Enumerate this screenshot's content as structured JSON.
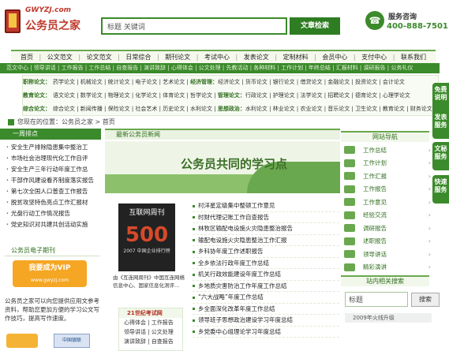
{
  "header": {
    "logo_en": "GWYZJ.com",
    "logo_cn": "公务员之家",
    "search_placeholder": "标题 关键词",
    "search_button": "文章检索",
    "service_title": "服务咨询",
    "service_phone": "400-888-7501"
  },
  "nav": {
    "items": [
      "首页",
      "公文范文",
      "论文范文",
      "日常综合",
      "期刊论文",
      "考试中心",
      "发表论文",
      "定制材料",
      "会员中心",
      "支付中心",
      "联系我们"
    ]
  },
  "subnav": {
    "text": "范文中心 | 领导讲话 | 工作报告 | 工作总结 | 自查报告 | 演讲致辞 | 心得体会 | 公文处理 | 先教活动 | 各种材料 | 工作计划 | 年终总结 | 汇报材料 | 调研报告 | 公务礼仪"
  },
  "categories": {
    "row1": {
      "lead": "职称论文：",
      "items": "药学论文 | 机械论文 | 统计论文 | 电子论文 | 艺术论文 |",
      "mid": "经济管理：",
      "tail": "经济论文 | 货币论文 | 银行论文 | 借贷论文 | 金融论文 | 投资论文 | 会计论文"
    },
    "row2": {
      "lead": "教育论文：",
      "items": "语文论文 | 数学论文 | 物理论文 | 化学论文 | 体育论文 | 哲学论文 |",
      "mid": "管理论文：",
      "tail": "行政论文 | 护理论文 | 法学论文 | 招聘论文 | 德育论文 | 心理学论文"
    },
    "row3": {
      "lead": "综合论文：",
      "items": "综合论文 | 新闻传播 | 保险论文 | 社会艺术 | 历史论文 | 水利论文 |",
      "mid": "思想政治：",
      "tail": "水利论文 | 林业论文 | 农业论文 | 音乐论文 | 卫生论文 | 教育论文 | 财务论文"
    }
  },
  "breadcrumb": "您现在的位置：公务员之家 > 首页",
  "left": {
    "head": "一周排点",
    "items": [
      "安全生产排除隐患集中整治工",
      "市场社会治理现代化工作自评",
      "安全生产三年行动年度工作总",
      "干部作风建设看齐制度落实报告",
      "第七次全国人口普查工作报告",
      "脱贫攻坚特色亮点工作汇报材",
      "光盘行动工作情况报告",
      "党史知识对共建共创活动实施"
    ],
    "ebook_head": "公务员电子期刊",
    "vip_text": "我要成为VIP",
    "vip_sub": "www.gwyzj.com",
    "para": "公务员之家可以向您提供应用文参考资料，帮助您更加方便的学习公文写作技巧，提高写作速度。",
    "bank": "中国银联"
  },
  "center": {
    "head": "最新公务员新闻",
    "banner": "公务员共同的学习点",
    "mag_title": "互联网周刊",
    "mag_big": "500",
    "mag_sub": "2007 中国企业排行榜",
    "mag_caption": "由《互连网周刊》中国互连网络信息中心、国家信息化测评...",
    "sub_head": "21世纪考试网",
    "sub_rows": [
      "心得体会 | 工作报告",
      "领导讲话 | 公文处理",
      "演讲致辞 | 自查报告"
    ],
    "news": [
      "村洋星定级集中整顿工作意见",
      "时财代理记账工作自查报告",
      "林牧区输配电设施火灾隐患整治报告",
      "输配电设施火灾隐患整治工作汇报",
      "乡科协年度工作述职报告",
      "全乡依法行政年度工作总结",
      "机关行政效能建设年度工作总结",
      "乡地质灾害防治工作年度工作总结",
      "“六大战略”年度工作总结",
      "乡全面深化改革年度工作总结",
      "领导班子思想政治建设学习年度总结",
      "乡党委中心组理论学习年度总结"
    ]
  },
  "right": {
    "head": "网站导航",
    "items": [
      "工作总结",
      "工作计划",
      "工作汇报",
      "工作报告",
      "工作意见",
      "经验交流",
      "调研报告",
      "述职报告",
      "领导讲话",
      "精彩演讲"
    ],
    "search_head": "站内相关搜索",
    "search_value": "标题",
    "search_button": "搜索",
    "upgrade": "2009年火线升级"
  },
  "tabs": [
    "免费说明",
    "发表服务",
    "文秘服务",
    "快速服务"
  ]
}
